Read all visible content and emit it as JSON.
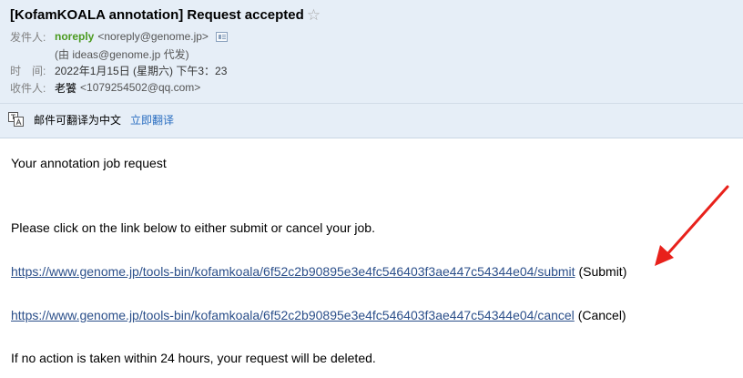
{
  "header": {
    "subject": "[KofamKOALA annotation] Request accepted",
    "star_glyph": "☆",
    "sender_label": "发件人:",
    "sender_name": "noreply",
    "sender_email": "<noreply@genome.jp>",
    "via_text": "(由 ideas@genome.jp 代发)",
    "time_label": "时　间:",
    "time_value": "2022年1月15日 (星期六) 下午3：23",
    "recipient_label": "收件人:",
    "recipient_name": "老饕",
    "recipient_email": "<1079254502@qq.com>"
  },
  "translate": {
    "message": "邮件可翻译为中文",
    "action": "立即翻译"
  },
  "body": {
    "line1": "Your annotation job request",
    "line2": "Please click on the link below to either submit or cancel your job.",
    "submit_url": "https://www.genome.jp/tools-bin/kofamkoala/6f52c2b90895e3e4fc546403f3ae447c54344e04/submit",
    "submit_suffix": "(Submit)",
    "cancel_url": "https://www.genome.jp/tools-bin/kofamkoala/6f52c2b90895e3e4fc546403f3ae447c54344e04/cancel",
    "cancel_suffix": "(Cancel)",
    "line_last": "If no action is taken within 24 hours, your request will be deleted."
  },
  "colors": {
    "header_bg": "#e6eef7",
    "sender_green": "#4a9a1f",
    "link_blue": "#2b4f8a",
    "translate_link": "#2a6ec1",
    "annotation_arrow": "#e8211b"
  },
  "icons": {
    "star": "star-icon",
    "contact": "contact-card-icon",
    "translate": "translate-icon",
    "annotation": "red-arrow-icon"
  }
}
